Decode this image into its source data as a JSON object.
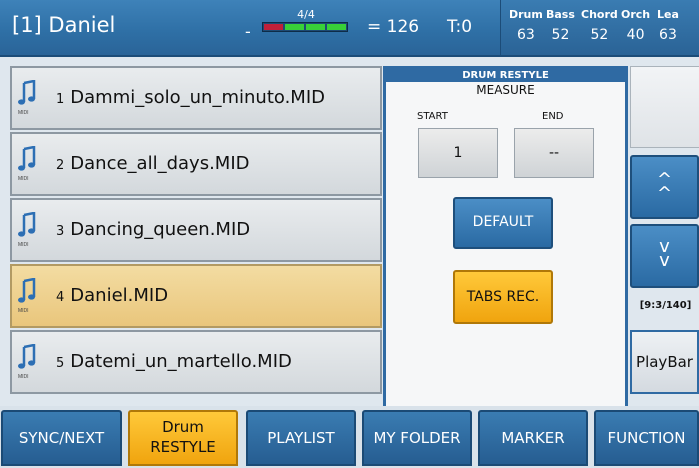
{
  "header": {
    "song": "[1] Daniel",
    "tempo_dash": "-",
    "time_signature": "4/4",
    "bpm": "= 126",
    "transpose": "T:0",
    "mixer": [
      {
        "name": "Drum",
        "value": "63"
      },
      {
        "name": "Bass",
        "value": "52"
      },
      {
        "name": "Chord",
        "value": "52"
      },
      {
        "name": "Orch",
        "value": "40"
      },
      {
        "name": "Lea",
        "value": "63"
      }
    ]
  },
  "files": [
    {
      "num": "1",
      "name": "Dammi_solo_un_minuto.MID"
    },
    {
      "num": "2",
      "name": "Dance_all_days.MID"
    },
    {
      "num": "3",
      "name": "Dancing_queen.MID"
    },
    {
      "num": "4",
      "name": "Daniel.MID"
    },
    {
      "num": "5",
      "name": "Datemi_un_martello.MID"
    }
  ],
  "file_icon_label": "MIDI",
  "panel": {
    "title": "DRUM RESTYLE",
    "measure": "MEASURE",
    "start_label": "START",
    "end_label": "END",
    "start_value": "1",
    "end_value": "--",
    "default_label": "DEFAULT",
    "tabs_label": "TABS REC."
  },
  "side": {
    "up": "^",
    "down": "v",
    "counter": "[9:3/140]",
    "playbar": "PlayBar"
  },
  "tabs": [
    {
      "line1": "SYNC/NEXT"
    },
    {
      "line1": "Drum",
      "line2": "RESTYLE"
    },
    {
      "line1": "PLAYLIST"
    },
    {
      "line1": "MY FOLDER"
    },
    {
      "line1": "MARKER"
    },
    {
      "line1": "FUNCTION"
    }
  ],
  "colors": {
    "accent_blue": "#2f6aa3",
    "selected": "#e9c67c",
    "highlight_orange": "#f0a40e"
  }
}
